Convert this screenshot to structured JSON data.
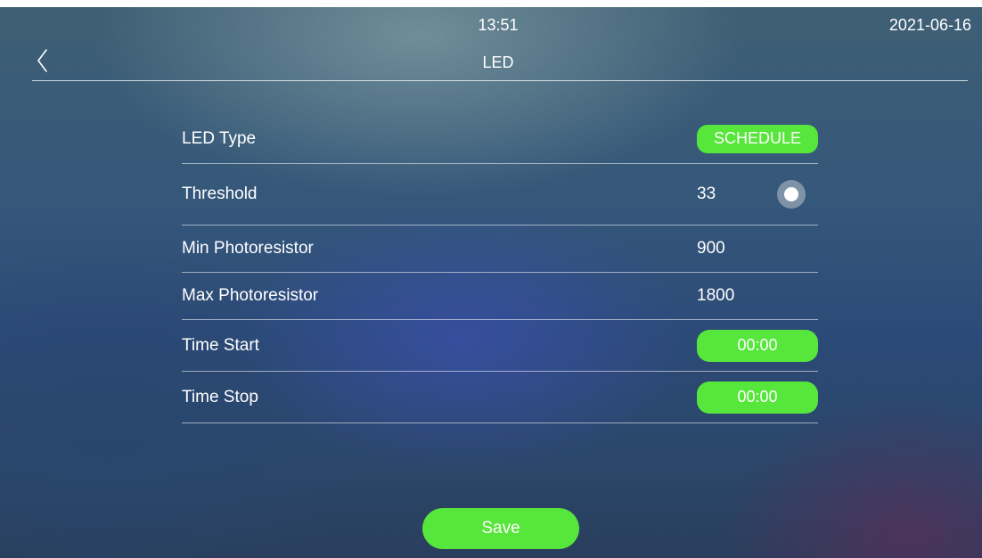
{
  "status_bar": {
    "time": "13:51",
    "date": "2021-06-16"
  },
  "header": {
    "title": "LED",
    "back_icon": "chevron-left-icon"
  },
  "settings": {
    "led_type": {
      "label": "LED Type",
      "value": "SCHEDULE"
    },
    "threshold": {
      "label": "Threshold",
      "value": "33",
      "toggle_icon": "radio-toggle-icon"
    },
    "min_photoresistor": {
      "label": "Min Photoresistor",
      "value": "900"
    },
    "max_photoresistor": {
      "label": "Max Photoresistor",
      "value": "1800"
    },
    "time_start": {
      "label": "Time Start",
      "value": "00:00"
    },
    "time_stop": {
      "label": "Time Stop",
      "value": "00:00"
    }
  },
  "save_button": {
    "label": "Save"
  },
  "colors": {
    "accent_green": "#57e63b",
    "text": "#ffffff"
  }
}
